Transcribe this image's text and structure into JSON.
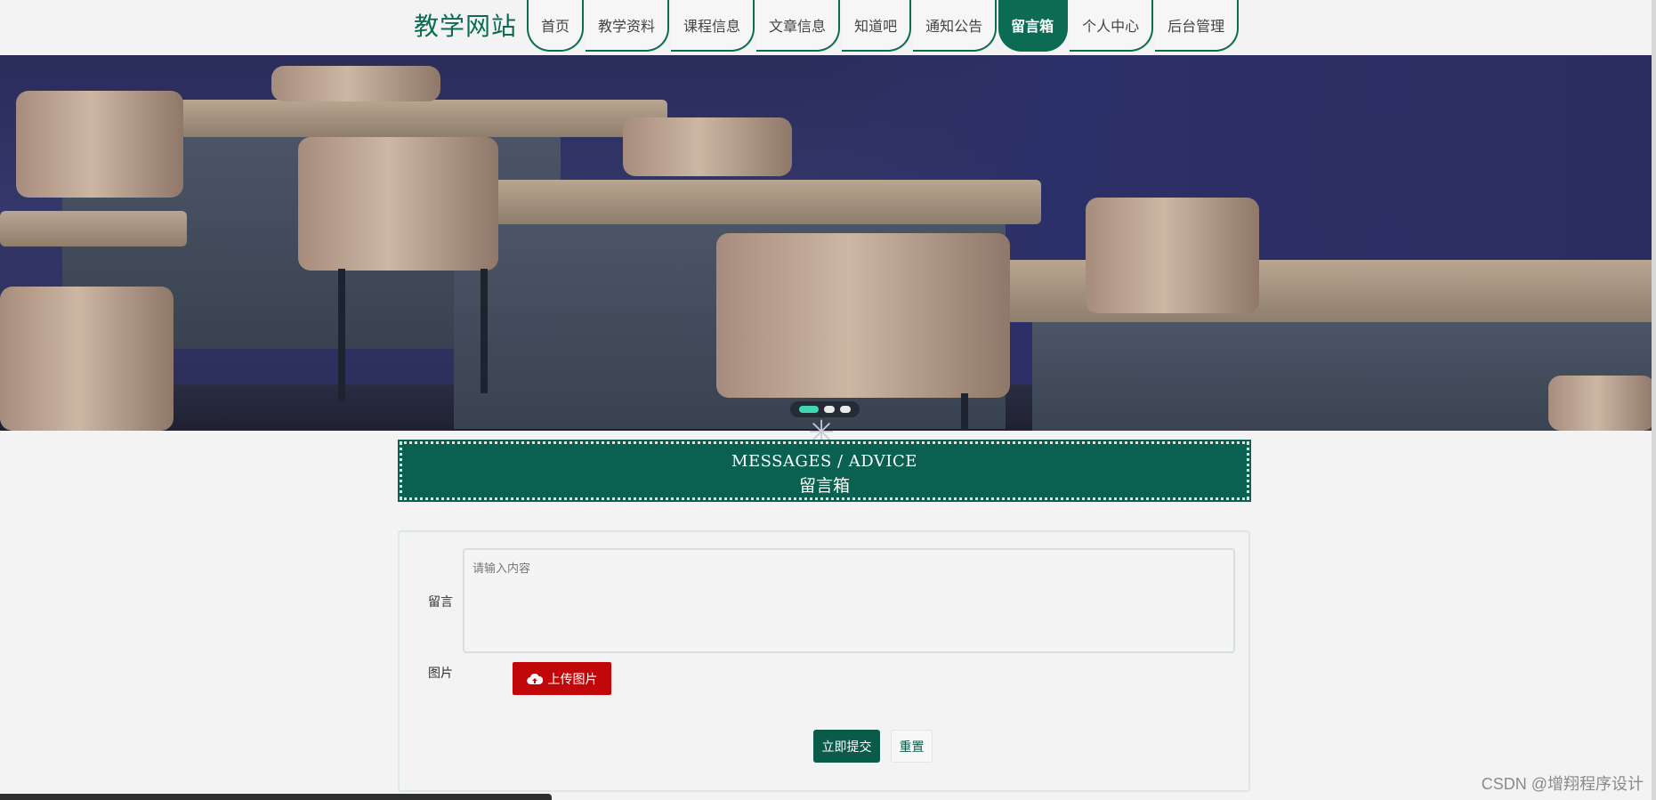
{
  "header": {
    "site_title": "教学网站",
    "nav": [
      {
        "label": "首页"
      },
      {
        "label": "教学资料"
      },
      {
        "label": "课程信息"
      },
      {
        "label": "文章信息"
      },
      {
        "label": "知道吧"
      },
      {
        "label": "通知公告"
      },
      {
        "label": "留言箱",
        "active": true
      },
      {
        "label": "个人中心"
      },
      {
        "label": "后台管理"
      }
    ]
  },
  "banner": {
    "slide_count": 3,
    "active_slide": 1
  },
  "section": {
    "title_en": "MESSAGES / ADVICE",
    "title_cn": "留言箱"
  },
  "form": {
    "message_label": "留言",
    "message_placeholder": "请输入内容",
    "image_label": "图片",
    "upload_label": "上传图片",
    "submit_label": "立即提交",
    "reset_label": "重置"
  },
  "watermark": "CSDN @增翔程序设计",
  "colors": {
    "primary": "#0b6b53",
    "upload": "#c0080a",
    "dot_active": "#43d6b5"
  }
}
